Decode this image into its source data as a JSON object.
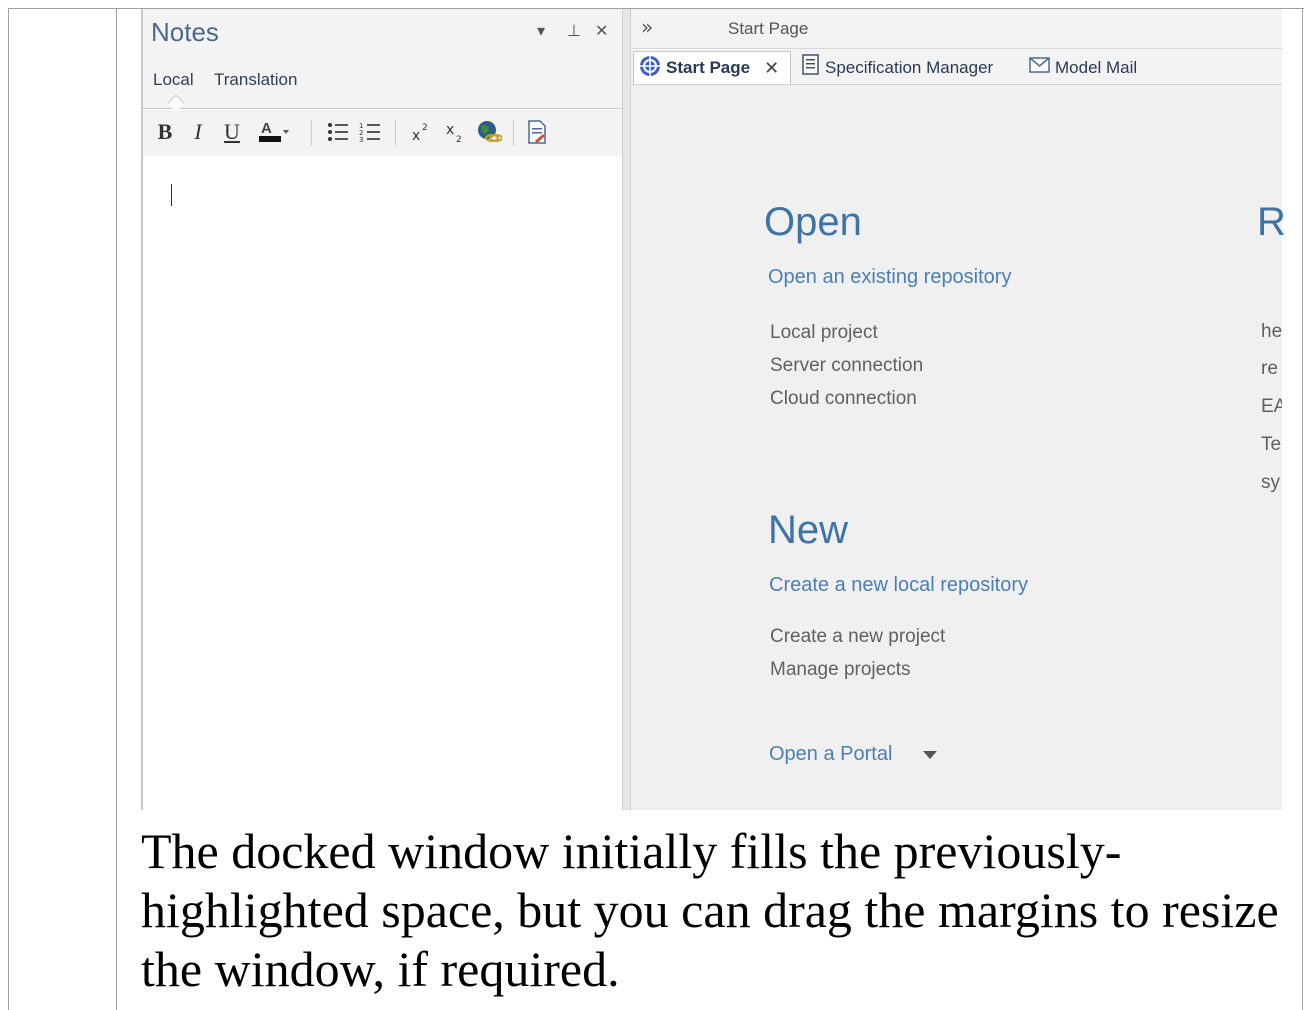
{
  "notes_panel": {
    "title": "Notes",
    "controls": {
      "dropdown": "▾",
      "pin": "⊥",
      "close": "✕"
    },
    "tabs": [
      "Local",
      "Translation"
    ],
    "toolbar": {
      "bold": "B",
      "italic": "I",
      "underline": "U",
      "color": "A"
    }
  },
  "start_panel": {
    "overflow_chevron": "»",
    "title": "Start Page",
    "tabs": [
      {
        "label": "Start Page",
        "close": "✕",
        "icon": "start-page-icon"
      },
      {
        "label": "Specification Manager",
        "icon": "document-icon"
      },
      {
        "label": "Model Mail",
        "icon": "mail-icon"
      }
    ],
    "open_section": {
      "heading": "Open",
      "subheading": "Open an existing repository",
      "items": [
        "Local project",
        "Server connection",
        "Cloud connection"
      ]
    },
    "new_section": {
      "heading": "New",
      "subheading": "Create a new local repository",
      "items": [
        "Create a new project",
        "Manage projects"
      ]
    },
    "portal_link": "Open a Portal",
    "recent_section": {
      "heading": "R",
      "items": [
        "he",
        "re",
        "EA",
        "Te",
        "sy"
      ]
    }
  },
  "caption": "The docked window initially fills the previously-highlighted space, but you can drag the margins to resize the window, if required.",
  "colors": {
    "accent_blue": "#3f73a8",
    "link_blue": "#4b7fb4",
    "panel_bg": "#f3f3f3",
    "content_bg": "#f0f0f0"
  }
}
